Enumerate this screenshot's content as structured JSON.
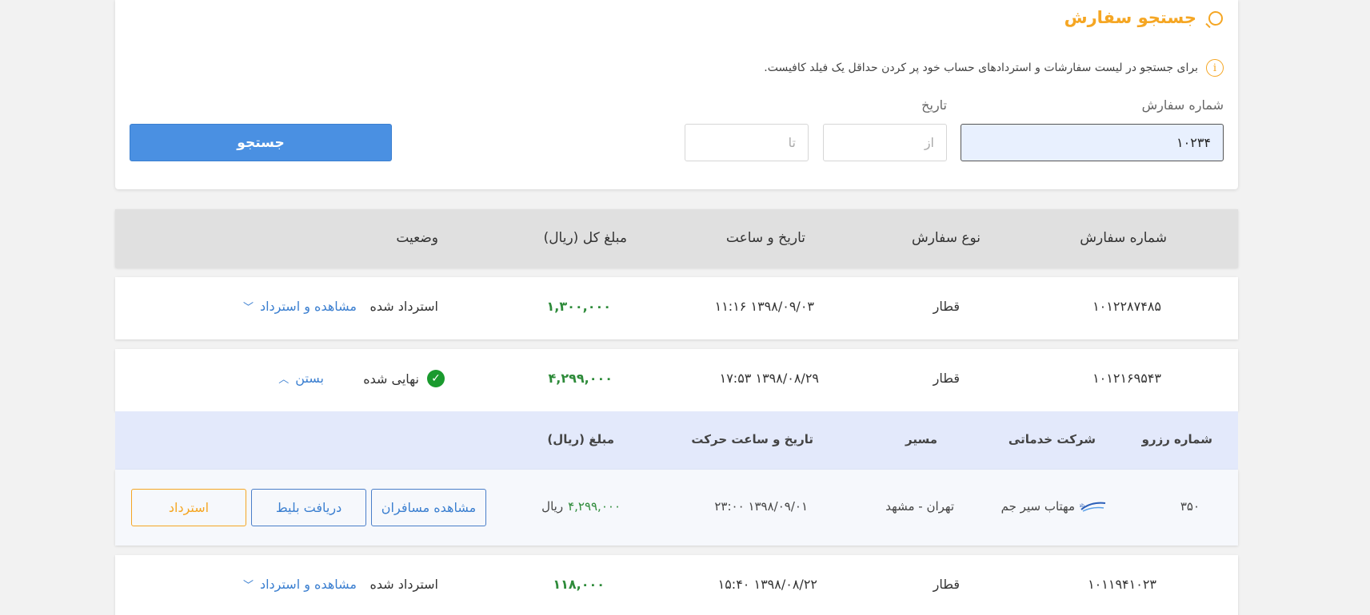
{
  "search": {
    "title": "جستجو سفارش",
    "info": "برای جستجو در لیست سفارشات و استردادهای حساب خود پر کردن حداقل یک فیلد کافیست.",
    "order_number_label": "شماره سفارش",
    "order_number_value": "۱۰۲۳۴",
    "date_label": "تاریخ",
    "date_from_placeholder": "از",
    "date_to_placeholder": "تا",
    "search_button": "جستجو"
  },
  "table": {
    "headers": [
      "شماره سفارش",
      "نوع سفارش",
      "تاریخ و ساعت",
      "مبلغ کل (ریال)",
      "وضعیت"
    ],
    "rows": [
      {
        "order_no": "۱۰۱۲۲۸۷۴۸۵",
        "type": "قطار",
        "datetime": "۱۳۹۸/۰۹/۰۳   ۱۱:۱۶",
        "amount": "۱,۳۰۰,۰۰۰",
        "status": "استرداد شده",
        "action": "مشاهده و استرداد"
      },
      {
        "order_no": "۱۰۱۲۱۶۹۵۴۳",
        "type": "قطار",
        "datetime": "۱۳۹۸/۰۸/۲۹   ۱۷:۵۳",
        "amount": "۴,۲۹۹,۰۰۰",
        "status": "نهایی شده",
        "action": "بستن"
      },
      {
        "order_no": "۱۰۱۱۹۴۱۰۲۳",
        "type": "قطار",
        "datetime": "۱۳۹۸/۰۸/۲۲   ۱۵:۴۰",
        "amount": "۱۱۸,۰۰۰",
        "status": "استرداد شده",
        "action": "مشاهده و استرداد"
      }
    ]
  },
  "detail": {
    "headers": [
      "شماره رزرو",
      "شرکت خدماتی",
      "مسیر",
      "تاریخ و ساعت حرکت",
      "مبلغ (ریال)"
    ],
    "reservation_no": "۳۵۰",
    "company": "مهتاب سیر جم",
    "route": "تهران - مشهد",
    "departure": "۱۳۹۸/۰۹/۰۱   ۲۳:۰۰",
    "amount": "۴,۲۹۹,۰۰۰",
    "currency": "ریال",
    "buttons": {
      "passengers": "مشاهده مسافران",
      "ticket": "دریافت بلیط",
      "refund": "استرداد"
    }
  },
  "colors": {
    "accent": "#f5a623",
    "primary": "#4a90e2",
    "amount": "#2e8b3a",
    "success": "#1a9a2e"
  }
}
